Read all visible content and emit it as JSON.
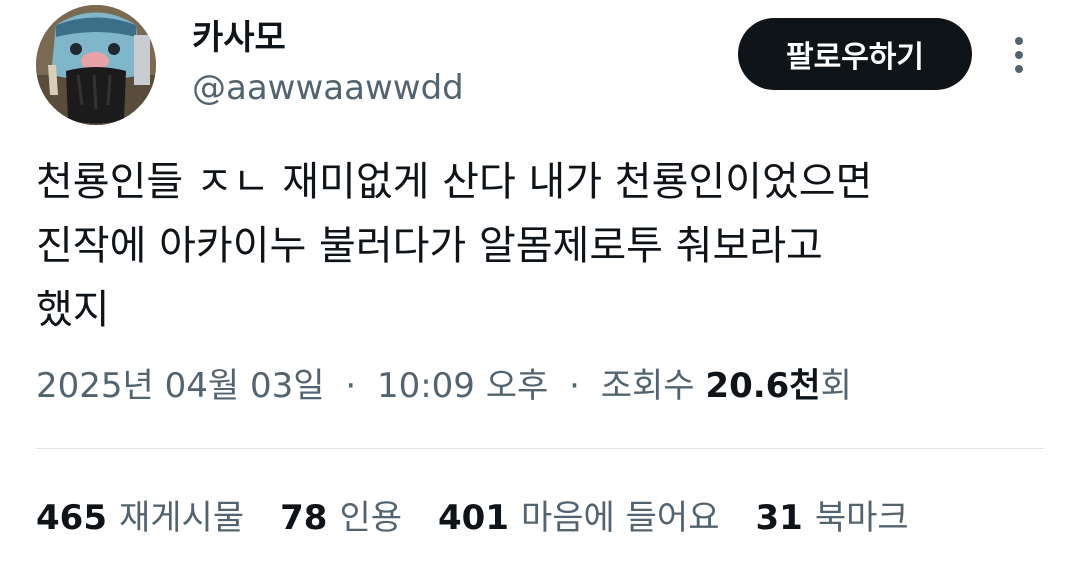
{
  "user": {
    "display_name": "카사모",
    "handle": "@aawwaawwdd"
  },
  "actions": {
    "follow_label": "팔로우하기",
    "more_icon": "more-vertical-icon"
  },
  "tweet": {
    "lines": [
      "천룡인들 ㅈㄴ 재미없게 산다 내가 천룡인이었으면",
      "진작에 아카이누 불러다가 알몸제로투 춰보라고",
      "했지"
    ]
  },
  "meta": {
    "date": "2025년 04월 03일",
    "separator": "·",
    "time": "10:09 오후",
    "views_label": "조회수",
    "views_count": "20.6천",
    "views_suffix": "회"
  },
  "stats": [
    {
      "count": "465",
      "label": "재게시물"
    },
    {
      "count": "78",
      "label": "인용"
    },
    {
      "count": "401",
      "label": "마음에 들어요"
    },
    {
      "count": "31",
      "label": "북마크"
    }
  ],
  "colors": {
    "text_primary": "#0f1419",
    "text_secondary": "#536471",
    "button_bg": "#0f1419",
    "divider": "#e1e6ea"
  }
}
